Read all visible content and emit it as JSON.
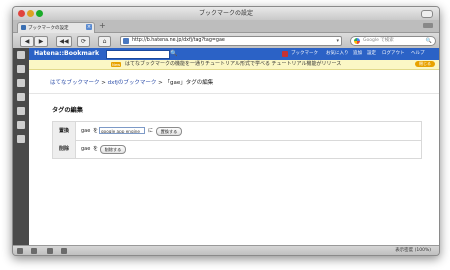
{
  "window": {
    "title": "ブックマークの設定"
  },
  "tab": {
    "label": "ブックマークの設定",
    "close": "×",
    "new_tab": "+"
  },
  "nav": {
    "back": "◀",
    "forward": "▶",
    "back_menu": "◀◀",
    "reload": "⟳",
    "home": "⌂",
    "url": "http://b.hatena.ne.jp/dxfj/tag?tag=gae",
    "url_dropdown": "▾",
    "search_placeholder": "Google で検索",
    "search_go": "🔍"
  },
  "hatena": {
    "logo": "Hatena::Bookmark",
    "search_button": "🔍",
    "links": [
      "ブックマーク",
      "お気に入り",
      "追加",
      "設定",
      "ログアウト",
      "ヘルプ"
    ]
  },
  "notice": {
    "badge": "New",
    "text": "はてなブックマークの機能を一通りチュートリアル形式で学べる チュートリアル機能がリリース",
    "close": "閉じる"
  },
  "breadcrumb": {
    "root": "はてなブックマーク",
    "sep1": " > ",
    "user": "dxfjのブックマーク",
    "sep2": " > ",
    "current": "「gae」タグの編集"
  },
  "section": {
    "title": "タグの編集"
  },
  "rows": [
    {
      "label": "置換",
      "tag": "gae",
      "particle": "を",
      "input_value": "google app engine",
      "particle2": "に",
      "button": "置換する"
    },
    {
      "label": "削除",
      "tag": "gae",
      "particle": "を",
      "button": "削除する"
    }
  ],
  "status": {
    "text": "表示密度 (100%)"
  },
  "colors": {
    "header_blue": "#2b62c6",
    "notice_bg": "#fbf7c5",
    "link": "#2b4ca8"
  }
}
